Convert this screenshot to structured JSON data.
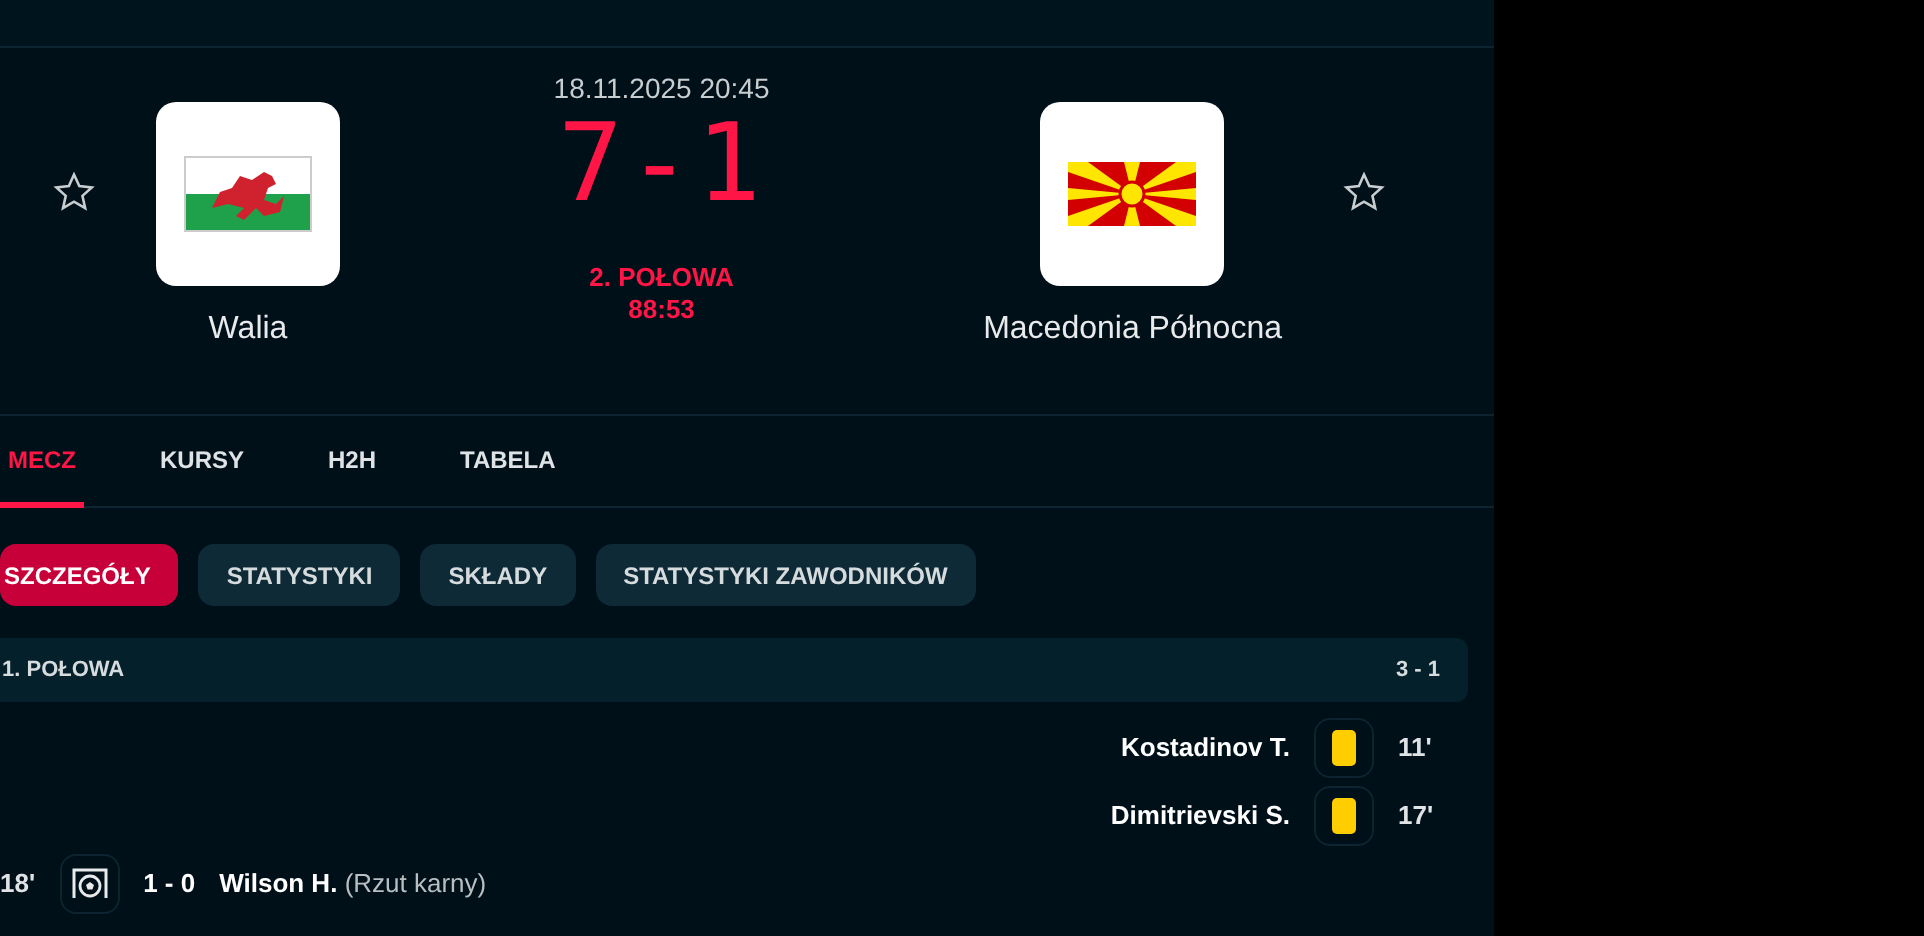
{
  "match": {
    "datetime": "18.11.2025 20:45",
    "score": "7-1",
    "status": "2. POŁOWA",
    "clock": "88:53",
    "home": {
      "name": "Walia",
      "favorite": false
    },
    "away": {
      "name": "Macedonia Północna",
      "favorite": false
    }
  },
  "tabs": [
    {
      "label": "MECZ",
      "selected": true
    },
    {
      "label": "KURSY",
      "selected": false
    },
    {
      "label": "H2H",
      "selected": false
    },
    {
      "label": "TABELA",
      "selected": false
    }
  ],
  "subtabs": [
    {
      "label": "SZCZEGÓŁY",
      "selected": true
    },
    {
      "label": "STATYSTYKI",
      "selected": false
    },
    {
      "label": "SKŁADY",
      "selected": false
    },
    {
      "label": "STATYSTYKI ZAWODNIKÓW",
      "selected": false
    }
  ],
  "period": {
    "label": "1. POŁOWA",
    "score": "3 - 1"
  },
  "events": [
    {
      "kind": "yellow_card",
      "away_team": true,
      "minute": "11'",
      "player": "Kostadinov T."
    },
    {
      "kind": "yellow_card",
      "away_team": true,
      "minute": "17'",
      "player": "Dimitrievski S."
    },
    {
      "kind": "goal",
      "away_team": false,
      "minute": "18'",
      "score": "1 - 0",
      "player": "Wilson H.",
      "note": "(Rzut karny)"
    }
  ]
}
